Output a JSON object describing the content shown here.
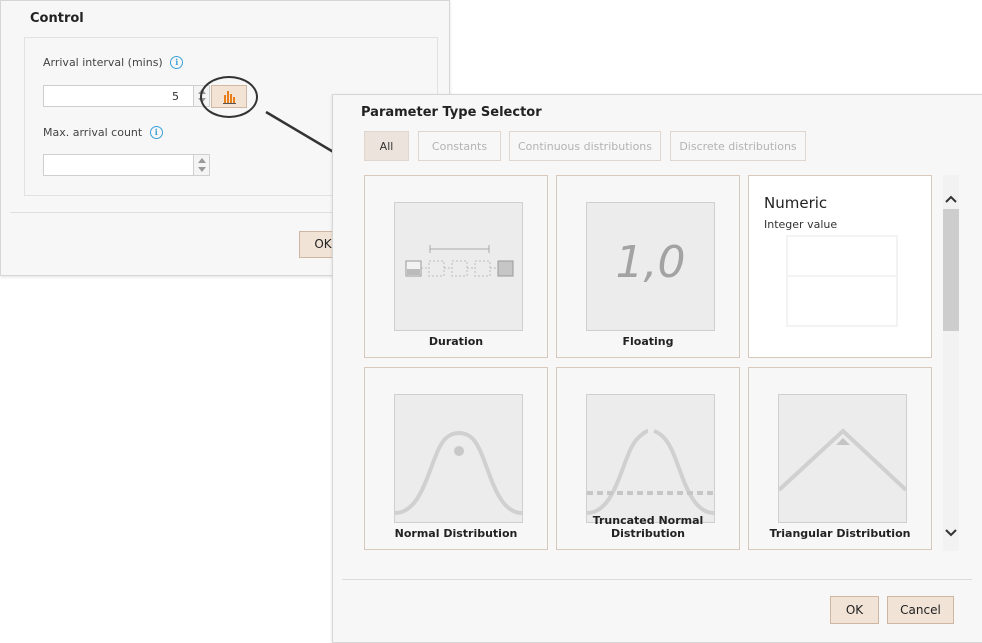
{
  "control": {
    "title": "Control",
    "arrival_interval_label": "Arrival interval (mins)",
    "arrival_interval_value": "5",
    "max_arrival_label": "Max. arrival count",
    "max_arrival_value": "",
    "info_glyph": "i",
    "ok_label": "OK"
  },
  "selector": {
    "title": "Parameter Type Selector",
    "tabs": [
      {
        "label": "All",
        "active": true
      },
      {
        "label": "Constants",
        "active": false
      },
      {
        "label": "Continuous distributions",
        "active": false
      },
      {
        "label": "Discrete distributions",
        "active": false
      }
    ],
    "cards": [
      {
        "label": "Duration",
        "icon": "duration-icon"
      },
      {
        "label": "Floating",
        "icon": "floating-icon",
        "glyph": "1,0"
      },
      {
        "label": "Numeric",
        "subtitle": "Integer value",
        "icon": "numeric-icon"
      },
      {
        "label": "Normal Distribution",
        "icon": "normal-distribution-icon"
      },
      {
        "label": "Truncated Normal Distribution",
        "icon": "truncated-normal-icon"
      },
      {
        "label": "Triangular Distribution",
        "icon": "triangular-distribution-icon"
      }
    ],
    "ok_label": "OK",
    "cancel_label": "Cancel"
  },
  "colors": {
    "accent_button": "#f1e3d6",
    "info_blue": "#3aa0d8",
    "chart_orange": "#e87e1c"
  }
}
